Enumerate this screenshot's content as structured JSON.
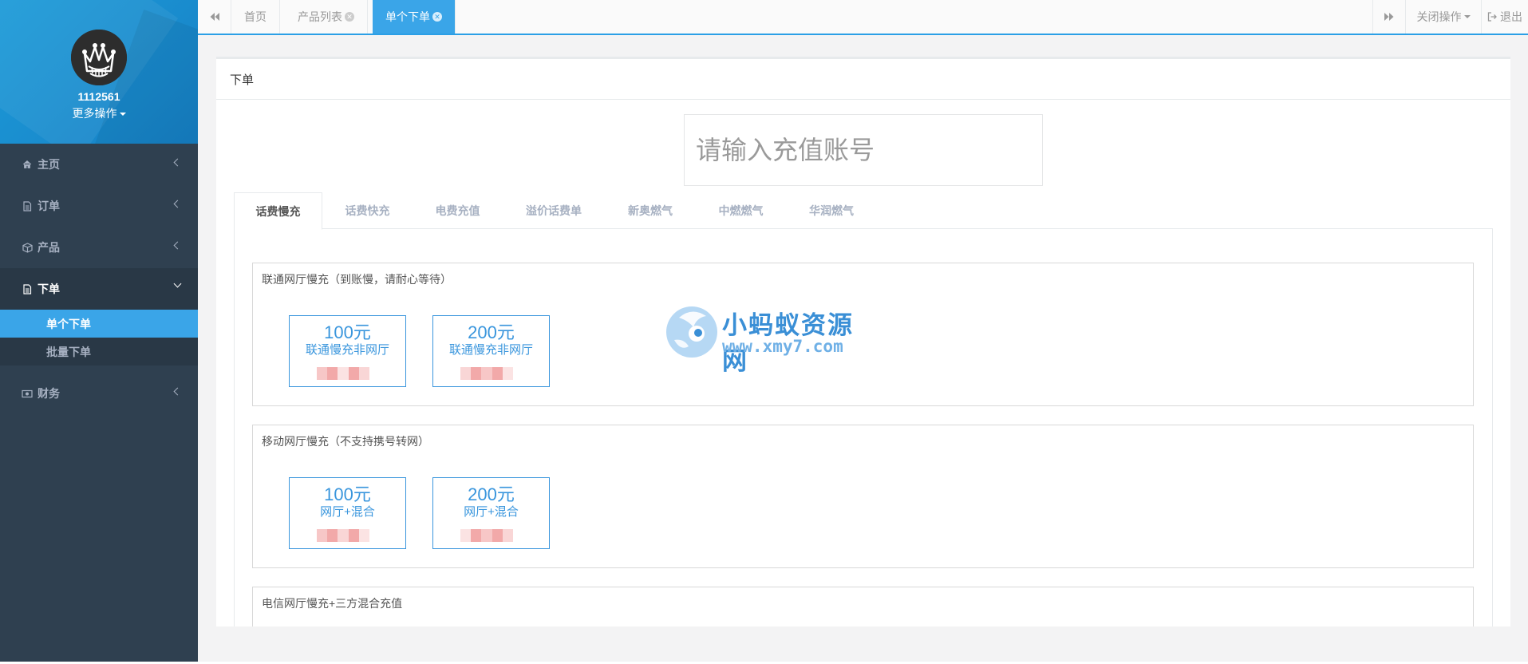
{
  "profile": {
    "username": "1112561",
    "more_label": "更多操作"
  },
  "sidebar": {
    "items": [
      {
        "label": "主页",
        "icon": "home-icon"
      },
      {
        "label": "订单",
        "icon": "file-icon"
      },
      {
        "label": "产品",
        "icon": "cube-icon"
      },
      {
        "label": "下单",
        "icon": "edit-icon",
        "expanded": true,
        "children": [
          {
            "label": "单个下单",
            "current": true
          },
          {
            "label": "批量下单"
          }
        ]
      },
      {
        "label": "财务",
        "icon": "money-icon"
      }
    ]
  },
  "topbar": {
    "tabs": [
      {
        "label": "首页",
        "closable": false
      },
      {
        "label": "产品列表",
        "closable": true
      },
      {
        "label": "单个下单",
        "closable": true,
        "active": true
      }
    ],
    "close_ops_label": "关闭操作",
    "logout_label": "退出"
  },
  "main": {
    "panel_title": "下单",
    "account_placeholder": "请输入充值账号",
    "product_tabs": [
      "话费慢充",
      "话费快充",
      "电费充值",
      "溢价话费单",
      "新奥燃气",
      "中燃燃气",
      "华润燃气"
    ],
    "active_product_tab": "话费慢充",
    "groups": [
      {
        "title": "联通网厅慢充（到账慢，请耐心等待）",
        "cards": [
          {
            "amount": "100元",
            "desc": "联通慢充非网厅"
          },
          {
            "amount": "200元",
            "desc": "联通慢充非网厅"
          }
        ]
      },
      {
        "title": "移动网厅慢充（不支持携号转网）",
        "cards": [
          {
            "amount": "100元",
            "desc": "网厅+混合"
          },
          {
            "amount": "200元",
            "desc": "网厅+混合"
          }
        ]
      },
      {
        "title": "电信网厅慢充+三方混合充值",
        "cards": []
      }
    ]
  },
  "watermark": {
    "name": "小蚂蚁资源网",
    "url": "www.xmy7.com"
  },
  "colors": {
    "sidebar_bg": "#2f4050",
    "accent": "#3aa5e8",
    "card_blue": "#3a96dd"
  }
}
